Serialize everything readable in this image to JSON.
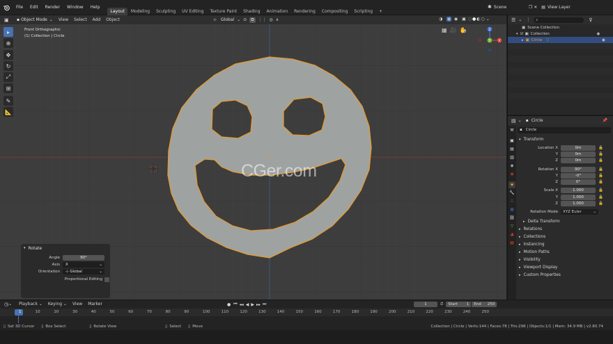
{
  "menus": [
    "File",
    "Edit",
    "Render",
    "Window",
    "Help"
  ],
  "workspaces": [
    "Layout",
    "Modeling",
    "Sculpting",
    "UV Editing",
    "Texture Paint",
    "Shading",
    "Animation",
    "Rendering",
    "Compositing",
    "Scripting"
  ],
  "active_workspace": "Layout",
  "scene_name": "Scene",
  "view_layer": "View Layer",
  "viewport": {
    "mode": "Object Mode",
    "view_menus": [
      "View",
      "Select",
      "Add",
      "Object"
    ],
    "transform_orientation": "Global",
    "view_name": "Front Orthographic",
    "collection_label": "(1) Collection | Circle",
    "watermark": "CGer.com",
    "gizmo_axes": [
      "X",
      "Y",
      "Z"
    ]
  },
  "operator_panel": {
    "title": "Rotate",
    "angle_label": "Angle",
    "angle_value": "90°",
    "axis_label": "Axis",
    "axis_value": "X",
    "orientation_label": "Orientation",
    "orientation_value": "Global",
    "proportional_label": "Proportional Editing"
  },
  "outliner": {
    "rows": [
      "Scene Collection",
      "Collection",
      "Circle"
    ]
  },
  "properties": {
    "object_name": "Circle",
    "data_name": "Circle",
    "transform_title": "Transform",
    "location_label": "Location X",
    "rotation_label": "Rotation X",
    "scale_label": "Scale X",
    "axis_y": "Y",
    "axis_z": "Z",
    "location": [
      "0m",
      "0m",
      "0m"
    ],
    "rotation": [
      "90°",
      "-0°",
      "0°"
    ],
    "scale": [
      "1.000",
      "1.000",
      "1.000"
    ],
    "rotation_mode_label": "Rotation Mode",
    "rotation_mode_value": "XYZ Euler",
    "delta_transform": "Delta Transform",
    "sections": [
      "Relations",
      "Collections",
      "Instancing",
      "Motion Paths",
      "Visibility",
      "Viewport Display",
      "Custom Properties"
    ]
  },
  "timeline": {
    "menus": [
      "Playback",
      "Keying",
      "View",
      "Marker"
    ],
    "current_frame": "1",
    "start_label": "Start",
    "start": "1",
    "end_label": "End",
    "end": "250",
    "ticks": [
      "1",
      "10",
      "20",
      "30",
      "40",
      "50",
      "60",
      "70",
      "80",
      "90",
      "100",
      "110",
      "120",
      "130",
      "140",
      "150",
      "160",
      "170",
      "180",
      "190",
      "200",
      "210",
      "220",
      "230",
      "240",
      "250"
    ]
  },
  "statusbar": {
    "left": [
      "Set 3D Cursor",
      "Box Select",
      "Rotate View",
      "Select",
      "Move"
    ],
    "right": "Collection | Circle | Verts:144 | Faces:78 | Tris:298 | Objects:1/1 | Mem: 34.9 MB | v2.80.74"
  },
  "colors": {
    "accent": "#4772b3",
    "selection_outline": "#e69a2e",
    "mesh_fill": "#9ea3a2",
    "viewport_bg": "#3d3d3d"
  }
}
